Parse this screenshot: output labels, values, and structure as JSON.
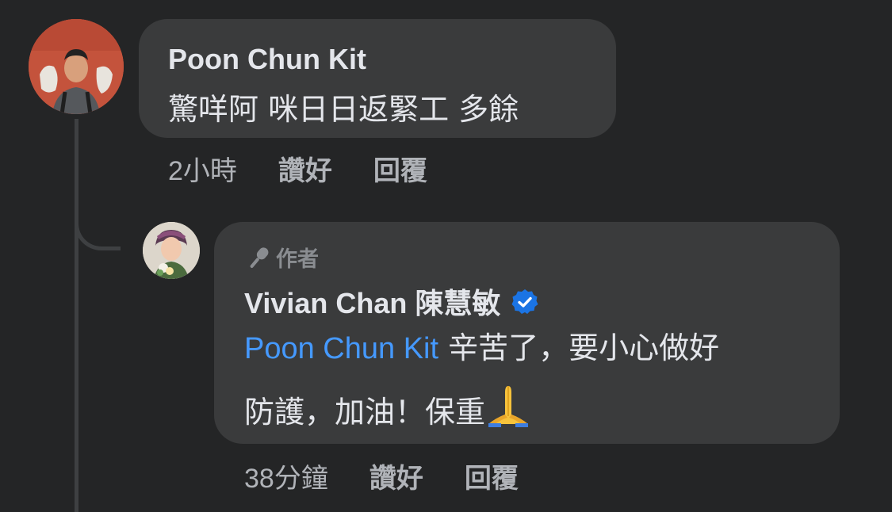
{
  "comment": {
    "author": "Poon Chun Kit",
    "text": "驚咩阿 咪日日返緊工 多餘",
    "time": "2小時",
    "like_label": "讚好",
    "reply_label": "回覆"
  },
  "reply": {
    "badge_label": "作者",
    "author": "Vivian Chan 陳慧敏",
    "mention": "Poon Chun Kit",
    "text_line1": " 辛苦了，要小心做好",
    "text_line2": "防護，加油！保重",
    "emoji": "folded-hands",
    "time": "38分鐘",
    "like_label": "讚好",
    "reply_label": "回覆"
  },
  "colors": {
    "background": "#242526",
    "bubble": "#3a3b3c",
    "primary_text": "#e4e6eb",
    "secondary_text": "#b0b3b8",
    "mention": "#4599ff",
    "verified": "#1b74e4"
  },
  "icons": {
    "badge": "microphone-icon",
    "verified": "verified-badge-icon"
  }
}
